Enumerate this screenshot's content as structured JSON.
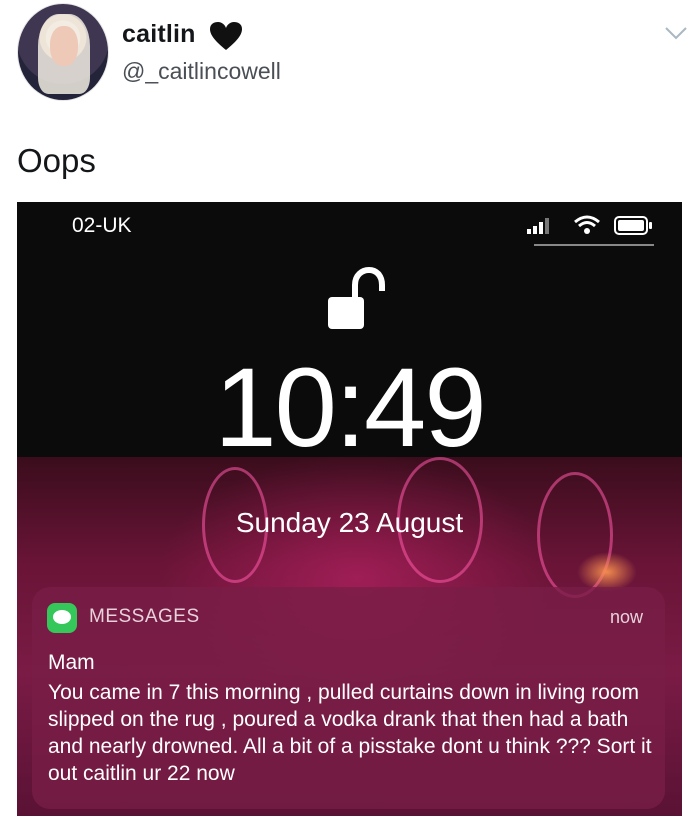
{
  "tweet": {
    "display_name": "caitlin",
    "handle": "@_caitlincowell",
    "text": "Oops",
    "icons": {
      "verified_like": "black-heart-icon",
      "menu": "chevron-down-icon"
    }
  },
  "lockscreen": {
    "carrier": "02-UK",
    "time": "10:49",
    "date": "Sunday 23 August",
    "notification": {
      "app_name": "MESSAGES",
      "time": "now",
      "sender": "Mam",
      "message": "You came in 7 this morning , pulled curtains down in living room slipped on the rug , poured a vodka drank that then had a bath and nearly drowned. All a bit of a pisstake dont u think ??? Sort it out caitlin ur 22 now"
    }
  },
  "colors": {
    "messages_green": "#35c759",
    "notif_bg": "#78224a"
  }
}
